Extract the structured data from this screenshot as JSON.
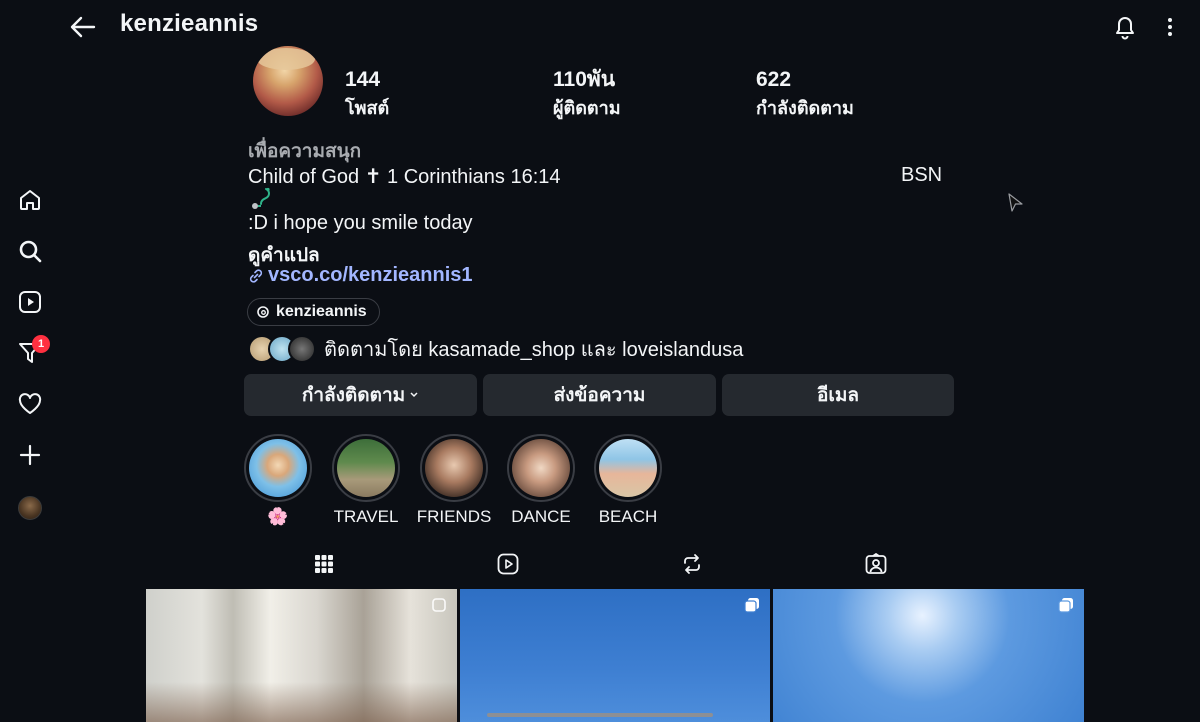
{
  "header": {
    "back_icon": "arrow-left-icon",
    "username": "kenzieannis",
    "bell_icon": "bell-icon",
    "more_icon": "more-vertical-icon"
  },
  "nav": {
    "items": [
      {
        "icon": "home-icon"
      },
      {
        "icon": "search-icon"
      },
      {
        "icon": "reels-icon"
      },
      {
        "icon": "messages-icon",
        "badge": "1"
      },
      {
        "icon": "heart-icon"
      },
      {
        "icon": "plus-icon"
      },
      {
        "icon": "profile-avatar-icon"
      }
    ]
  },
  "profile": {
    "stats": {
      "posts_count": "144",
      "posts_label": "โพสต์",
      "followers_count": "110พัน",
      "followers_label": "ผู้ติดตาม",
      "following_count": "622",
      "following_label": "กำลังติดตาม"
    },
    "category": "เพื่อความสนุก",
    "bio_line1": "Child of God ✝ 1 Corinthians 16:14",
    "bio_bsn": "BSN",
    "bio_line2_icon": "stethoscope-icon",
    "bio_line3": ":D i hope you smile today",
    "see_translation": "ดูคำแปล",
    "link": "vsco.co/kenzieannis1",
    "threads_handle": "kenzieannis",
    "followed_by": "ติดตามโดย kasamade_shop และ loveislandusa"
  },
  "actions": {
    "following": "กำลังติดตาม",
    "message": "ส่งข้อความ",
    "email": "อีเมล"
  },
  "highlights": [
    {
      "label": "🌸"
    },
    {
      "label": "TRAVEL"
    },
    {
      "label": "FRIENDS"
    },
    {
      "label": "DANCE"
    },
    {
      "label": "BEACH"
    }
  ],
  "tabs": [
    {
      "icon": "grid-icon"
    },
    {
      "icon": "reels-tab-icon"
    },
    {
      "icon": "reposts-icon"
    },
    {
      "icon": "tagged-icon"
    }
  ],
  "colors": {
    "background": "#0b0e14",
    "button": "#25292f",
    "link": "#a2b6ff",
    "badge": "#ff3040"
  }
}
